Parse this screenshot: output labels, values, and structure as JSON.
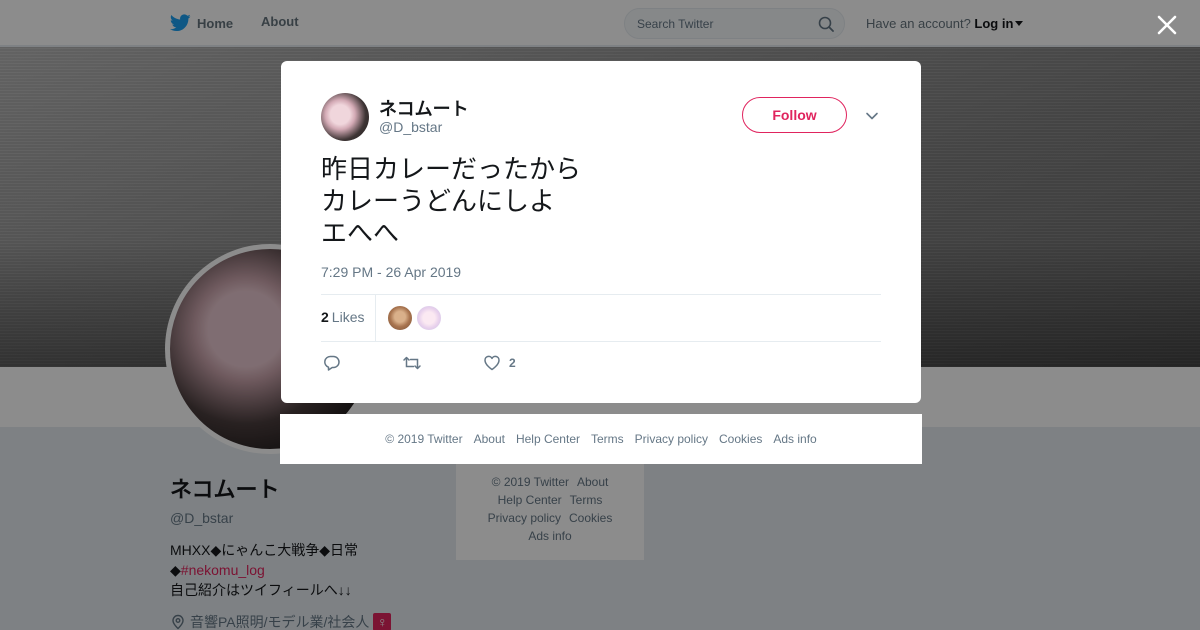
{
  "topbar": {
    "home_label": "Home",
    "about_label": "About",
    "search_placeholder": "Search Twitter",
    "account_prompt": "Have an account?",
    "login_label": "Log in"
  },
  "profile": {
    "name": "ネコムート",
    "handle": "@D_bstar",
    "bio_line1": "MHXX◆にゃんこ大戦争◆日常",
    "bio_line2_prefix": "◆",
    "bio_hashtag": "#nekomu_log",
    "bio_line3": "自己紹介はツイフィールへ↓↓",
    "location": "音響PA照明/モデル業/社会人",
    "location_emoji": "♀"
  },
  "side_footer": {
    "links": [
      "© 2019 Twitter",
      "About",
      "Help Center",
      "Terms",
      "Privacy policy",
      "Cookies",
      "Ads info"
    ]
  },
  "tweet": {
    "author_name": "ネコムート",
    "author_handle": "@D_bstar",
    "follow_label": "Follow",
    "text_lines": [
      "昨日カレーだったから",
      "カレーうどんにしよ",
      "エへへ"
    ],
    "timestamp": "7:29 PM - 26 Apr 2019",
    "likes_count": "2",
    "likes_label": "Likes",
    "like_action_count": "2"
  },
  "modal_footer": {
    "links": [
      "© 2019 Twitter",
      "About",
      "Help Center",
      "Terms",
      "Privacy policy",
      "Cookies",
      "Ads info"
    ]
  },
  "colors": {
    "accent": "#e0245e",
    "twitter_blue": "#1da1f2",
    "muted": "#657786"
  }
}
